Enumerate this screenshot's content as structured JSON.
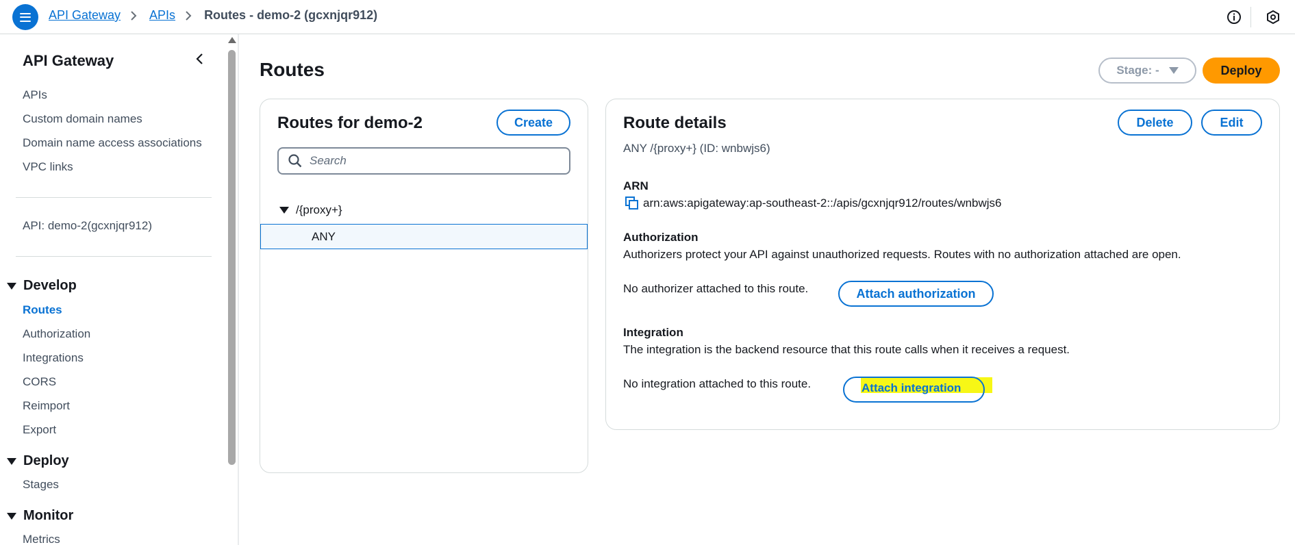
{
  "topbar": {
    "breadcrumbs": [
      "API Gateway",
      "APIs"
    ],
    "current": "Routes - demo-2 (gcxnjqr912)"
  },
  "sidebar": {
    "title": "API Gateway",
    "top_links": [
      "APIs",
      "Custom domain names",
      "Domain name access associations",
      "VPC links"
    ],
    "api_label": "API: demo-2(gcxnjqr912)",
    "develop": {
      "title": "Develop",
      "items": [
        "Routes",
        "Authorization",
        "Integrations",
        "CORS",
        "Reimport",
        "Export"
      ],
      "active": "Routes"
    },
    "deploy": {
      "title": "Deploy",
      "items": [
        "Stages"
      ]
    },
    "monitor": {
      "title": "Monitor",
      "items": [
        "Metrics"
      ]
    }
  },
  "main": {
    "title": "Routes",
    "stage_label": "Stage: -",
    "deploy_label": "Deploy",
    "routes_panel": {
      "heading": "Routes for demo-2",
      "create_label": "Create",
      "search_placeholder": "Search",
      "tree": {
        "path": "/{proxy+}",
        "methods": [
          "ANY"
        ]
      }
    },
    "details_panel": {
      "heading": "Route details",
      "delete_label": "Delete",
      "edit_label": "Edit",
      "route_summary": "ANY /{proxy+} (ID: wnbwjs6)",
      "arn_label": "ARN",
      "arn_value": "arn:aws:apigateway:ap-southeast-2::/apis/gcxnjqr912/routes/wnbwjs6",
      "authorization_label": "Authorization",
      "authorization_desc": "Authorizers protect your API against unauthorized requests. Routes with no authorization attached are open.",
      "authorization_status": "No authorizer attached to this route.",
      "attach_authorization_label": "Attach authorization",
      "integration_label": "Integration",
      "integration_desc": "The integration is the backend resource that this route calls when it receives a request.",
      "integration_status": "No integration attached to this route.",
      "attach_integration_label": "Attach integration"
    }
  },
  "colors": {
    "accent": "#0972d3",
    "deploy": "#ff9900",
    "highlight": "#f7f716"
  },
  "icons": [
    "menu-icon",
    "chevron-right-icon",
    "info-icon",
    "settings-hex-icon",
    "chevron-left-icon",
    "search-icon",
    "copy-icon",
    "caret-down-icon"
  ]
}
